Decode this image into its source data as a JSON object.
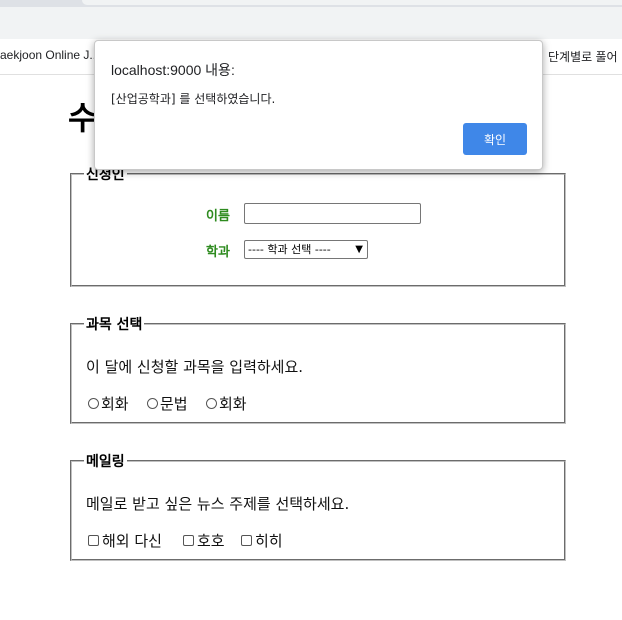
{
  "browser": {
    "bookmark_left": "aekjoon Online J...",
    "bookmark_right": "단계별로 풀어"
  },
  "page": {
    "title": "수",
    "applicant": {
      "legend": "신청인",
      "name_label": "이름",
      "name_value": "",
      "dept_label": "학과",
      "dept_selected": "---- 학과 선택 ----"
    },
    "subject": {
      "legend": "과목 선택",
      "instruction": "이 달에 신청할 과목을 입력하세요.",
      "options": [
        "회화",
        "문법",
        "회화"
      ]
    },
    "mailing": {
      "legend": "메일링",
      "instruction": "메일로 받고 싶은 뉴스 주제를 선택하세요.",
      "options": [
        "해외 다신",
        "호호",
        "히히"
      ]
    }
  },
  "dialog": {
    "title": "localhost:9000 내용:",
    "message": "[산업공학과] 를 선택하였습니다.",
    "ok_label": "확인",
    "ok_color": "#3f87e8"
  }
}
